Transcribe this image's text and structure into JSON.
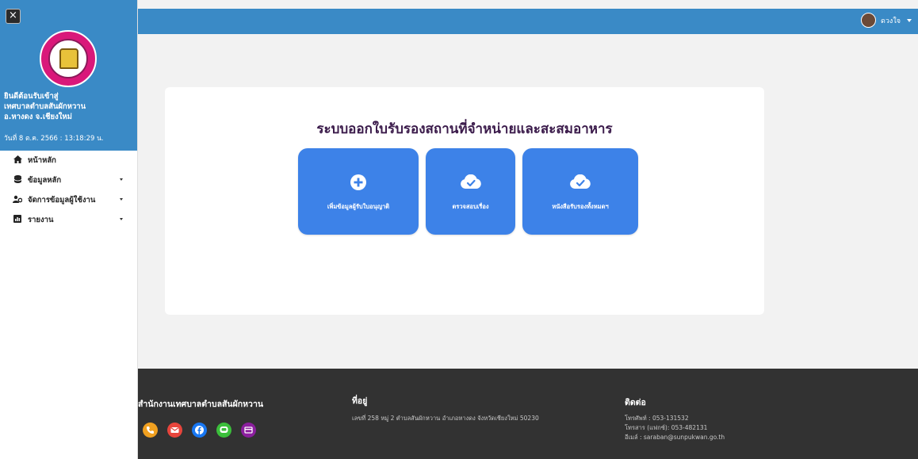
{
  "sidebar": {
    "close_label": "×",
    "welcome": [
      "ยินดีต้อนรับเข้าสู่",
      "เทศบาลตำบลสันผักหวาน",
      "อ.หางดง จ.เชียงใหม่"
    ],
    "datetime": "วันที่ 8 ต.ค. 2566 : 13:18:29 น.",
    "menu": [
      {
        "label": "หน้าหลัก",
        "icon": "home-icon",
        "has_submenu": false
      },
      {
        "label": "ข้อมูลหลัก",
        "icon": "database-icon",
        "has_submenu": true
      },
      {
        "label": "จัดการข้อมูลผู้ใช้งาน",
        "icon": "users-cog-icon",
        "has_submenu": true
      },
      {
        "label": "รายงาน",
        "icon": "chart-icon",
        "has_submenu": true
      }
    ]
  },
  "topbar": {
    "username": "ดวงใจ"
  },
  "main": {
    "title": "ระบบออกใบรับรองสถานที่จำหน่ายและสะสมอาหาร",
    "tiles": [
      {
        "label": "เพิ่มข้อมูลผู้รับใบอนุญาติ",
        "icon": "plus-circle-icon"
      },
      {
        "label": "ตรวจสอบเรื่อง",
        "icon": "cloud-check-icon"
      },
      {
        "label": "หนังสือรับรองทั้งหมดฯ",
        "icon": "cloud-check-icon"
      }
    ]
  },
  "footer": {
    "org_title": "สำนักงานเทศบาลตำบลสันผักหวาน",
    "address_title": "ที่อยู่",
    "address": "เลขที่ 258 หมู่ 2 ตำบลสันผักหวาน อำเภอหางดง จังหวัดเชียงใหม่ 50230",
    "contact_title": "ติดต่อ",
    "contact": [
      "โทรศัพท์ : 053-131532",
      "โทรสาร (แฟกซ์): 053-482131",
      "อีเมล์ : saraban@sunpukwan.go.th"
    ],
    "socials": [
      {
        "name": "phone-icon",
        "color": "#f0a020"
      },
      {
        "name": "mail-icon",
        "color": "#e8453c"
      },
      {
        "name": "facebook-icon",
        "color": "#1877f2"
      },
      {
        "name": "line-icon",
        "color": "#3bbf3b"
      },
      {
        "name": "card-icon",
        "color": "#8b1f9e"
      }
    ]
  }
}
